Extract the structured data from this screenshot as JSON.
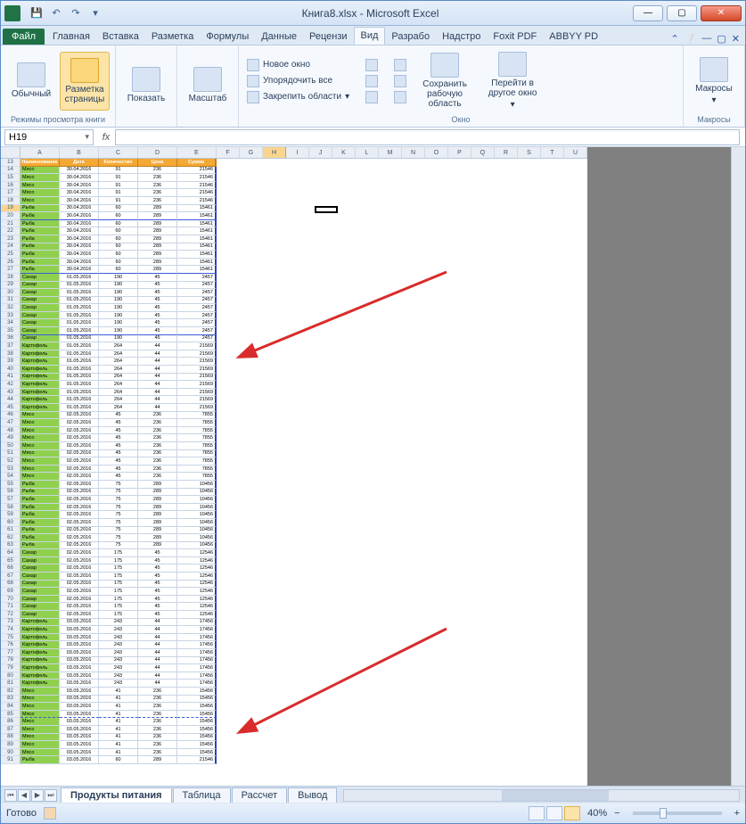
{
  "title": "Книга8.xlsx - Microsoft Excel",
  "qat": {
    "save": "💾",
    "undo": "↶",
    "redo": "↷"
  },
  "tabs": {
    "file": "Файл",
    "home": "Главная",
    "insert": "Вставка",
    "layout": "Разметка",
    "formulas": "Формулы",
    "data": "Данные",
    "review": "Рецензи",
    "view": "Вид",
    "dev": "Разрабо",
    "addins": "Надстро",
    "foxit": "Foxit PDF",
    "abbyy": "ABBYY PD"
  },
  "ribbon": {
    "normal": "Обычный",
    "pagelayout": "Разметка страницы",
    "show": "Показать",
    "zoom": "Масштаб",
    "newwin": "Новое окно",
    "arrange": "Упорядочить все",
    "freeze": "Закрепить области",
    "savews": "Сохранить рабочую область",
    "switchwin": "Перейти в другое окно",
    "macros": "Макросы",
    "g_views": "Режимы просмотра книги",
    "g_window": "Окно",
    "g_macros": "Макросы"
  },
  "namebox": "H19",
  "fx": "fx",
  "cols": [
    "A",
    "B",
    "C",
    "D",
    "E",
    "F",
    "G",
    "H",
    "I",
    "J",
    "K",
    "L",
    "M",
    "N",
    "O",
    "P",
    "Q",
    "R",
    "S",
    "T",
    "U"
  ],
  "headers": [
    "Наименование",
    "Дата",
    "Количество",
    "Цена",
    "Сумма"
  ],
  "rows": [
    {
      "n": 14,
      "a": "Мясо",
      "b": "30.04.2016",
      "c": 91,
      "d": 236,
      "e": 21546,
      "g": 1
    },
    {
      "n": 15,
      "a": "Мясо",
      "b": "30.04.2016",
      "c": 91,
      "d": 236,
      "e": 21546,
      "g": 1
    },
    {
      "n": 16,
      "a": "Мясо",
      "b": "30.04.2016",
      "c": 91,
      "d": 236,
      "e": 21546,
      "g": 1
    },
    {
      "n": 17,
      "a": "Мясо",
      "b": "30.04.2016",
      "c": 91,
      "d": 236,
      "e": 21546,
      "g": 1
    },
    {
      "n": 18,
      "a": "Мясо",
      "b": "30.04.2016",
      "c": 91,
      "d": 236,
      "e": 21546,
      "g": 1
    },
    {
      "n": 19,
      "a": "Рыба",
      "b": "30.04.2016",
      "c": 60,
      "d": 289,
      "e": 15461,
      "g": 1,
      "sel": 1
    },
    {
      "n": 20,
      "a": "Рыба",
      "b": "30.04.2016",
      "c": 60,
      "d": 289,
      "e": 15461,
      "g": 1,
      "blue": 1
    },
    {
      "n": 21,
      "a": "Рыба",
      "b": "30.04.2016",
      "c": 60,
      "d": 289,
      "e": 15461,
      "g": 1
    },
    {
      "n": 22,
      "a": "Рыба",
      "b": "30.04.2016",
      "c": 60,
      "d": 289,
      "e": 15461,
      "g": 1
    },
    {
      "n": 23,
      "a": "Рыба",
      "b": "30.04.2016",
      "c": 60,
      "d": 289,
      "e": 15461,
      "g": 1
    },
    {
      "n": 24,
      "a": "Рыба",
      "b": "30.04.2016",
      "c": 60,
      "d": 289,
      "e": 15461,
      "g": 1
    },
    {
      "n": 25,
      "a": "Рыба",
      "b": "30.04.2016",
      "c": 60,
      "d": 289,
      "e": 15461,
      "g": 1
    },
    {
      "n": 26,
      "a": "Рыба",
      "b": "30.04.2016",
      "c": 60,
      "d": 289,
      "e": 15461,
      "g": 1
    },
    {
      "n": 27,
      "a": "Рыба",
      "b": "30.04.2016",
      "c": 60,
      "d": 289,
      "e": 15461,
      "g": 1,
      "blue": 1
    },
    {
      "n": 28,
      "a": "Сахар",
      "b": "01.05.2016",
      "c": 190,
      "d": 45,
      "e": 2457,
      "g": 1
    },
    {
      "n": 29,
      "a": "Сахар",
      "b": "01.05.2016",
      "c": 190,
      "d": 45,
      "e": 2457,
      "g": 1
    },
    {
      "n": 30,
      "a": "Сахар",
      "b": "01.05.2016",
      "c": 190,
      "d": 45,
      "e": 2457,
      "g": 1
    },
    {
      "n": 31,
      "a": "Сахар",
      "b": "01.05.2016",
      "c": 190,
      "d": 45,
      "e": 2457,
      "g": 1
    },
    {
      "n": 32,
      "a": "Сахар",
      "b": "01.05.2016",
      "c": 190,
      "d": 45,
      "e": 2457,
      "g": 1
    },
    {
      "n": 33,
      "a": "Сахар",
      "b": "01.05.2016",
      "c": 190,
      "d": 45,
      "e": 2457,
      "g": 1
    },
    {
      "n": 34,
      "a": "Сахар",
      "b": "01.05.2016",
      "c": 190,
      "d": 45,
      "e": 2457,
      "g": 1
    },
    {
      "n": 35,
      "a": "Сахар",
      "b": "01.05.2016",
      "c": 190,
      "d": 45,
      "e": 2457,
      "g": 1,
      "blue": 1
    },
    {
      "n": 36,
      "a": "Сахар",
      "b": "01.05.2016",
      "c": 190,
      "d": 45,
      "e": 2457,
      "g": 1
    },
    {
      "n": 37,
      "a": "Картофель",
      "b": "01.05.2016",
      "c": 264,
      "d": 44,
      "e": 21569,
      "g": 1
    },
    {
      "n": 38,
      "a": "Картофель",
      "b": "01.05.2016",
      "c": 264,
      "d": 44,
      "e": 21569,
      "g": 1
    },
    {
      "n": 39,
      "a": "Картофель",
      "b": "01.05.2016",
      "c": 264,
      "d": 44,
      "e": 21569,
      "g": 1
    },
    {
      "n": 40,
      "a": "Картофель",
      "b": "01.05.2016",
      "c": 264,
      "d": 44,
      "e": 21569,
      "g": 1
    },
    {
      "n": 41,
      "a": "Картофель",
      "b": "01.05.2016",
      "c": 264,
      "d": 44,
      "e": 21569,
      "g": 1
    },
    {
      "n": 42,
      "a": "Картофель",
      "b": "01.05.2016",
      "c": 264,
      "d": 44,
      "e": 21569,
      "g": 1
    },
    {
      "n": 43,
      "a": "Картофель",
      "b": "01.05.2016",
      "c": 264,
      "d": 44,
      "e": 21569,
      "g": 1
    },
    {
      "n": 44,
      "a": "Картофель",
      "b": "01.05.2016",
      "c": 264,
      "d": 44,
      "e": 21569,
      "g": 1
    },
    {
      "n": 45,
      "a": "Картофель",
      "b": "01.05.2016",
      "c": 264,
      "d": 44,
      "e": 21569,
      "g": 1
    },
    {
      "n": 46,
      "a": "Мясо",
      "b": "02.05.2016",
      "c": 45,
      "d": 236,
      "e": 7855,
      "g": 1
    },
    {
      "n": 47,
      "a": "Мясо",
      "b": "02.05.2016",
      "c": 45,
      "d": 236,
      "e": 7855,
      "g": 1
    },
    {
      "n": 48,
      "a": "Мясо",
      "b": "02.05.2016",
      "c": 45,
      "d": 236,
      "e": 7855,
      "g": 1
    },
    {
      "n": 49,
      "a": "Мясо",
      "b": "02.05.2016",
      "c": 45,
      "d": 236,
      "e": 7855,
      "g": 1
    },
    {
      "n": 50,
      "a": "Мясо",
      "b": "02.05.2016",
      "c": 45,
      "d": 236,
      "e": 7855,
      "g": 1
    },
    {
      "n": 51,
      "a": "Мясо",
      "b": "02.05.2016",
      "c": 45,
      "d": 236,
      "e": 7855,
      "g": 1
    },
    {
      "n": 52,
      "a": "Мясо",
      "b": "02.05.2016",
      "c": 45,
      "d": 236,
      "e": 7855,
      "g": 1
    },
    {
      "n": 53,
      "a": "Мясо",
      "b": "02.05.2016",
      "c": 45,
      "d": 236,
      "e": 7855,
      "g": 1
    },
    {
      "n": 54,
      "a": "Мясо",
      "b": "02.05.2016",
      "c": 45,
      "d": 236,
      "e": 7855,
      "g": 1
    },
    {
      "n": 55,
      "a": "Рыба",
      "b": "02.05.2016",
      "c": 75,
      "d": 289,
      "e": 10456,
      "g": 1
    },
    {
      "n": 56,
      "a": "Рыба",
      "b": "02.05.2016",
      "c": 75,
      "d": 289,
      "e": 10456,
      "g": 1
    },
    {
      "n": 57,
      "a": "Рыба",
      "b": "02.05.2016",
      "c": 75,
      "d": 289,
      "e": 10456,
      "g": 1
    },
    {
      "n": 58,
      "a": "Рыба",
      "b": "02.05.2016",
      "c": 75,
      "d": 289,
      "e": 10456,
      "g": 1
    },
    {
      "n": 59,
      "a": "Рыба",
      "b": "02.05.2016",
      "c": 75,
      "d": 289,
      "e": 10456,
      "g": 1
    },
    {
      "n": 60,
      "a": "Рыба",
      "b": "02.05.2016",
      "c": 75,
      "d": 289,
      "e": 10456,
      "g": 1
    },
    {
      "n": 61,
      "a": "Рыба",
      "b": "02.05.2016",
      "c": 75,
      "d": 289,
      "e": 10456,
      "g": 1
    },
    {
      "n": 62,
      "a": "Рыба",
      "b": "02.05.2016",
      "c": 75,
      "d": 289,
      "e": 10456,
      "g": 1
    },
    {
      "n": 63,
      "a": "Рыба",
      "b": "02.05.2016",
      "c": 75,
      "d": 289,
      "e": 10456,
      "g": 1
    },
    {
      "n": 64,
      "a": "Сахар",
      "b": "02.05.2016",
      "c": 175,
      "d": 45,
      "e": 12546,
      "g": 1
    },
    {
      "n": 65,
      "a": "Сахар",
      "b": "02.05.2016",
      "c": 175,
      "d": 45,
      "e": 12546,
      "g": 1
    },
    {
      "n": 66,
      "a": "Сахар",
      "b": "02.05.2016",
      "c": 175,
      "d": 45,
      "e": 12546,
      "g": 1
    },
    {
      "n": 67,
      "a": "Сахар",
      "b": "02.05.2016",
      "c": 175,
      "d": 45,
      "e": 12546,
      "g": 1
    },
    {
      "n": 68,
      "a": "Сахар",
      "b": "02.05.2016",
      "c": 175,
      "d": 45,
      "e": 12546,
      "g": 1
    },
    {
      "n": 69,
      "a": "Сахар",
      "b": "02.05.2016",
      "c": 175,
      "d": 45,
      "e": 12546,
      "g": 1
    },
    {
      "n": 70,
      "a": "Сахар",
      "b": "02.05.2016",
      "c": 175,
      "d": 45,
      "e": 12546,
      "g": 1
    },
    {
      "n": 71,
      "a": "Сахар",
      "b": "02.05.2016",
      "c": 175,
      "d": 45,
      "e": 12546,
      "g": 1
    },
    {
      "n": 72,
      "a": "Сахар",
      "b": "02.05.2016",
      "c": 175,
      "d": 45,
      "e": 12546,
      "g": 1
    },
    {
      "n": 73,
      "a": "Картофель",
      "b": "03.05.2016",
      "c": 243,
      "d": 44,
      "e": 17456,
      "g": 1
    },
    {
      "n": 74,
      "a": "Картофель",
      "b": "03.05.2016",
      "c": 243,
      "d": 44,
      "e": 17456,
      "g": 1
    },
    {
      "n": 75,
      "a": "Картофель",
      "b": "03.05.2016",
      "c": 243,
      "d": 44,
      "e": 17456,
      "g": 1
    },
    {
      "n": 76,
      "a": "Картофель",
      "b": "03.05.2016",
      "c": 243,
      "d": 44,
      "e": 17456,
      "g": 1
    },
    {
      "n": 77,
      "a": "Картофель",
      "b": "03.05.2016",
      "c": 243,
      "d": 44,
      "e": 17456,
      "g": 1
    },
    {
      "n": 78,
      "a": "Картофель",
      "b": "03.05.2016",
      "c": 243,
      "d": 44,
      "e": 17456,
      "g": 1
    },
    {
      "n": 79,
      "a": "Картофель",
      "b": "03.05.2016",
      "c": 243,
      "d": 44,
      "e": 17456,
      "g": 1
    },
    {
      "n": 80,
      "a": "Картофель",
      "b": "03.05.2016",
      "c": 243,
      "d": 44,
      "e": 17456,
      "g": 1
    },
    {
      "n": 81,
      "a": "Картофель",
      "b": "03.05.2016",
      "c": 243,
      "d": 44,
      "e": 17456,
      "g": 1
    },
    {
      "n": 82,
      "a": "Мясо",
      "b": "03.05.2016",
      "c": 41,
      "d": 236,
      "e": 15456,
      "g": 1
    },
    {
      "n": 83,
      "a": "Мясо",
      "b": "03.05.2016",
      "c": 41,
      "d": 236,
      "e": 15456,
      "g": 1
    },
    {
      "n": 84,
      "a": "Мясо",
      "b": "03.05.2016",
      "c": 41,
      "d": 236,
      "e": 15456,
      "g": 1
    },
    {
      "n": 85,
      "a": "Мясо",
      "b": "03.05.2016",
      "c": 41,
      "d": 236,
      "e": 15456,
      "g": 1,
      "dashed": 1
    },
    {
      "n": 86,
      "a": "Мясо",
      "b": "03.05.2016",
      "c": 41,
      "d": 236,
      "e": 15456,
      "g": 1
    },
    {
      "n": 87,
      "a": "Мясо",
      "b": "03.05.2016",
      "c": 41,
      "d": 236,
      "e": 15456,
      "g": 1
    },
    {
      "n": 88,
      "a": "Мясо",
      "b": "03.05.2016",
      "c": 41,
      "d": 236,
      "e": 15456,
      "g": 1
    },
    {
      "n": 89,
      "a": "Мясо",
      "b": "03.05.2016",
      "c": 41,
      "d": 236,
      "e": 15456,
      "g": 1
    },
    {
      "n": 90,
      "a": "Мясо",
      "b": "03.05.2016",
      "c": 41,
      "d": 236,
      "e": 15456,
      "g": 1
    },
    {
      "n": 91,
      "a": "Рыба",
      "b": "03.05.2016",
      "c": 60,
      "d": 289,
      "e": 21546,
      "g": 1
    }
  ],
  "sheet_tabs": [
    "Продукты питания",
    "Таблица",
    "Рассчет",
    "Вывод"
  ],
  "status": {
    "ready": "Готово",
    "zoom": "40%"
  },
  "zoom_controls": {
    "minus": "−",
    "plus": "+"
  }
}
